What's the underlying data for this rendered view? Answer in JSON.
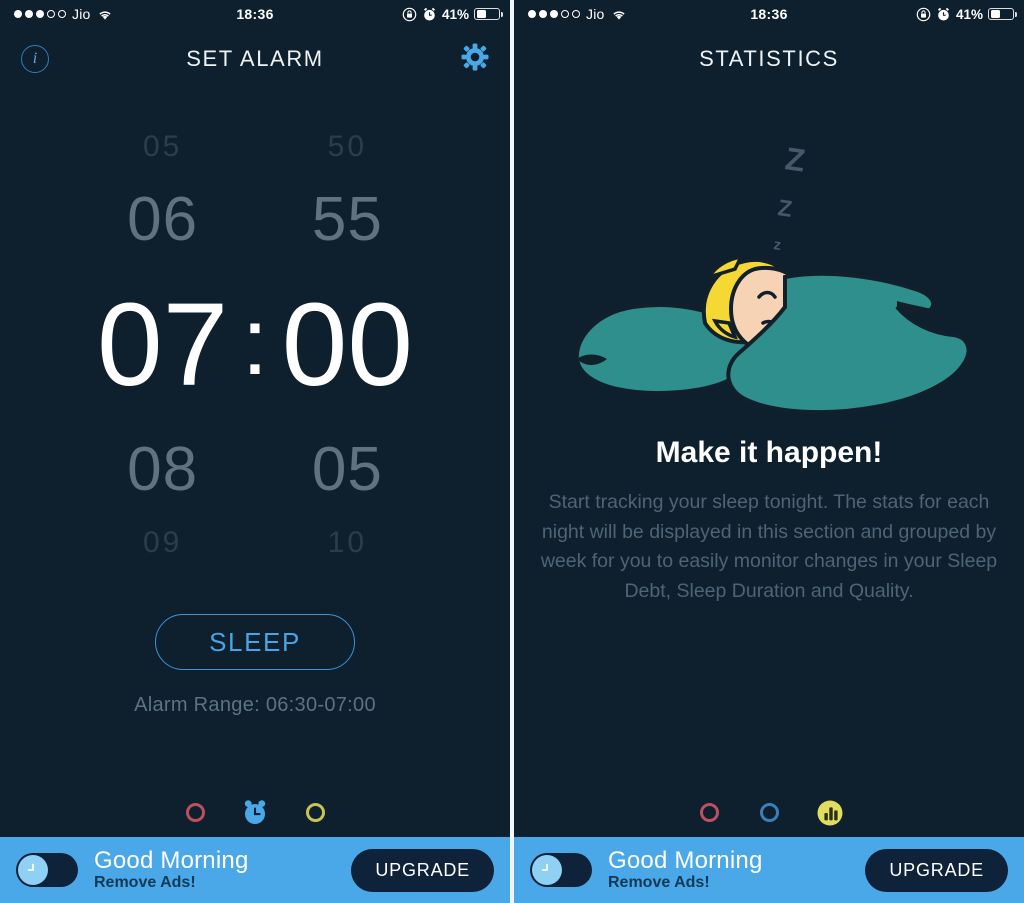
{
  "statusbar": {
    "carrier": "Jio",
    "time": "18:36",
    "battery_percent": "41%",
    "signal_dots_filled": 3,
    "signal_dots_total": 5,
    "wifi_icon": "wifi-icon",
    "rotation_lock_icon": "rotation-lock-icon",
    "alarm_icon": "alarm-clock-icon",
    "battery_icon": "battery-icon",
    "battery_fill_ratio": 0.41
  },
  "left_screen": {
    "nav": {
      "title": "SET ALARM",
      "info_icon": "info-circle-icon",
      "info_label": "i",
      "gear_icon": "gear-icon"
    },
    "picker": {
      "hours": {
        "far_above": "05",
        "near_above": "06",
        "selected": "07",
        "near_below": "08",
        "far_below": "09"
      },
      "separator": ":",
      "minutes": {
        "far_above": "50",
        "near_above": "55",
        "selected": "00",
        "near_below": "05",
        "far_below": "10"
      }
    },
    "sleep_button": "SLEEP",
    "alarm_range": "Alarm Range: 06:30-07:00",
    "tabs": [
      {
        "name": "tab-mood",
        "icon": "circle-outline-icon",
        "color": "#b9515f",
        "active": false
      },
      {
        "name": "tab-alarm",
        "icon": "alarm-clock-filled-icon",
        "color": "#4aa8e8",
        "active": true
      },
      {
        "name": "tab-statistics",
        "icon": "circle-outline-icon",
        "color": "#c9c254",
        "active": false
      }
    ]
  },
  "right_screen": {
    "nav": {
      "title": "STATISTICS"
    },
    "illustration": {
      "icon": "sleeping-person-illustration",
      "snore_letters": [
        "Z",
        "Z",
        "z"
      ],
      "blanket_color": "#2f8f8c",
      "hair_color": "#f5d833",
      "skin_color": "#f6d3b4"
    },
    "headline": "Make it happen!",
    "description": "Start tracking your sleep tonight.\nThe stats for each night will be displayed in this section and grouped by week for you to easily monitor changes in your Sleep Debt, Sleep Duration and Quality.",
    "tabs": [
      {
        "name": "tab-mood",
        "icon": "circle-outline-icon",
        "color": "#b9515f",
        "active": false
      },
      {
        "name": "tab-alarm",
        "icon": "circle-outline-icon",
        "color": "#3a7fba",
        "active": false
      },
      {
        "name": "tab-statistics",
        "icon": "bar-chart-filled-icon",
        "color": "#e3dd5e",
        "active": true
      }
    ]
  },
  "ad_banner": {
    "title": "Good Morning",
    "subtitle": "Remove Ads!",
    "upgrade_label": "UPGRADE",
    "toggle_icon": "clock-toggle-icon",
    "background_color": "#4aa8e8"
  },
  "theme": {
    "background": "#0e1f2d",
    "accent_blue": "#4aa8e8",
    "muted_text": "#4d6576"
  }
}
